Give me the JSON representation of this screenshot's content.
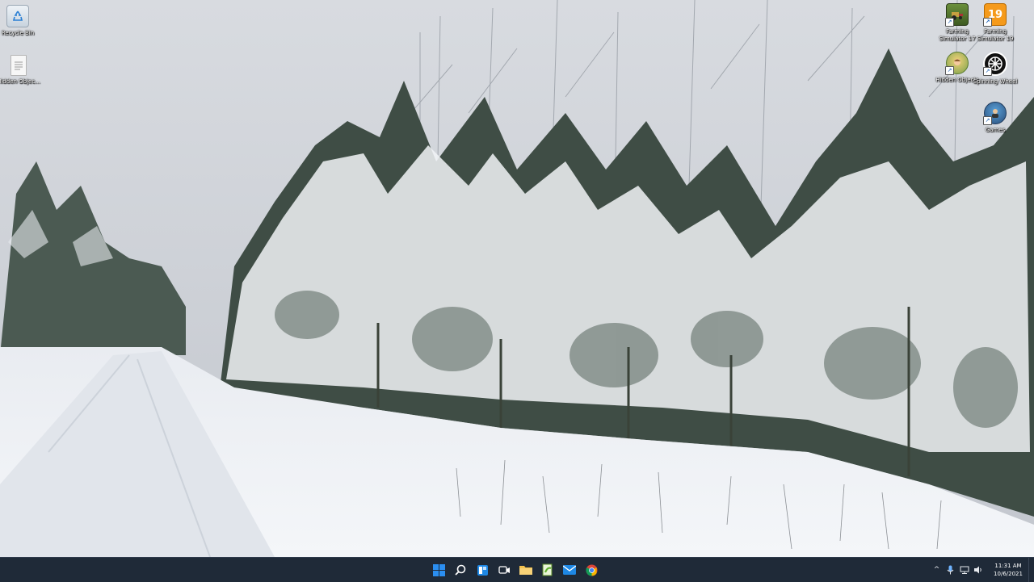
{
  "desktop": {
    "left_icons": [
      {
        "label": "Recycle Bin",
        "icon": "recycle-bin-icon"
      },
      {
        "label": "Hidden Objec...",
        "icon": "text-file-icon"
      }
    ],
    "right_icons": [
      {
        "label": "Farming Simulator 17",
        "icon": "farming-simulator-17-icon"
      },
      {
        "label": "Farming Simulator 19",
        "icon": "farming-simulator-19-icon"
      },
      {
        "label": "Hidden Objects",
        "icon": "hidden-objects-game-icon"
      },
      {
        "label": "Spinning Wheel",
        "icon": "wheel-app-icon"
      },
      {
        "label": "Games",
        "icon": "games-shortcut-icon"
      }
    ],
    "fs19_badge": "19"
  },
  "taskbar": {
    "apps": [
      {
        "name": "start",
        "icon": "windows-start-icon"
      },
      {
        "name": "search",
        "icon": "search-icon"
      },
      {
        "name": "widgets",
        "icon": "widgets-icon"
      },
      {
        "name": "chat",
        "icon": "teams-chat-icon"
      },
      {
        "name": "file-explorer",
        "icon": "folder-icon"
      },
      {
        "name": "notepad-plus-plus",
        "icon": "notepad-plus-plus-icon"
      },
      {
        "name": "mail",
        "icon": "mail-icon"
      },
      {
        "name": "chrome",
        "icon": "chrome-icon"
      }
    ],
    "tray": {
      "chevron": "^",
      "time": "11:31 AM",
      "date": "10/6/2021"
    }
  },
  "colors": {
    "taskbar_bg": "#1f2a38",
    "start_blue": "#2b8ef0",
    "folder_yellow": "#f2c14e",
    "mail_blue": "#1e88e5"
  }
}
